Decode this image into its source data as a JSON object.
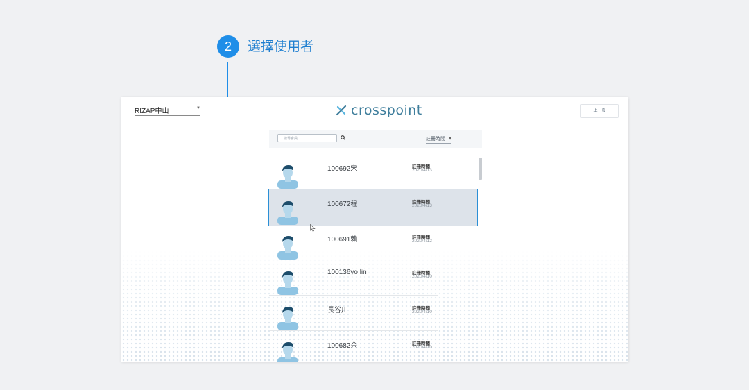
{
  "callout": {
    "step_number": "2",
    "label": "選擇使用者"
  },
  "header": {
    "branch": "RIZAP中山",
    "logo_text": "crosspoint",
    "prev_button": "上一頁"
  },
  "toolbar": {
    "search_placeholder": "搜尋會員",
    "sort_label": "註冊時間"
  },
  "members": [
    {
      "name": "100692宋",
      "reg_label": "註冊時間",
      "reg_date": "2020/4/13"
    },
    {
      "name": "100672程",
      "reg_label": "註冊時間",
      "reg_date": "2020/4/13",
      "selected": true
    },
    {
      "name": "100691賴",
      "reg_label": "註冊時間",
      "reg_date": "2020/4/12"
    },
    {
      "name": "100136yo lin",
      "reg_label": "註冊時間",
      "reg_date": "2020/4/10"
    },
    {
      "name": "長谷川",
      "reg_label": "註冊時間",
      "reg_date": "2020/4/10"
    },
    {
      "name": "100682余",
      "reg_label": "註冊時間",
      "reg_date": "2020/4/10"
    }
  ],
  "colors": {
    "accent": "#1f8ee8",
    "selected_row_bg": "#dde3ea",
    "logo": "#3f7e9c",
    "avatar_body": "#8fc4e3",
    "avatar_hair": "#1d4d6b"
  },
  "icons": {
    "search": "search-icon",
    "logo_mark": "crosspoint-logo-icon",
    "avatar": "user-avatar-icon",
    "cursor": "mouse-pointer-icon",
    "caret": "chevron-down-icon"
  }
}
